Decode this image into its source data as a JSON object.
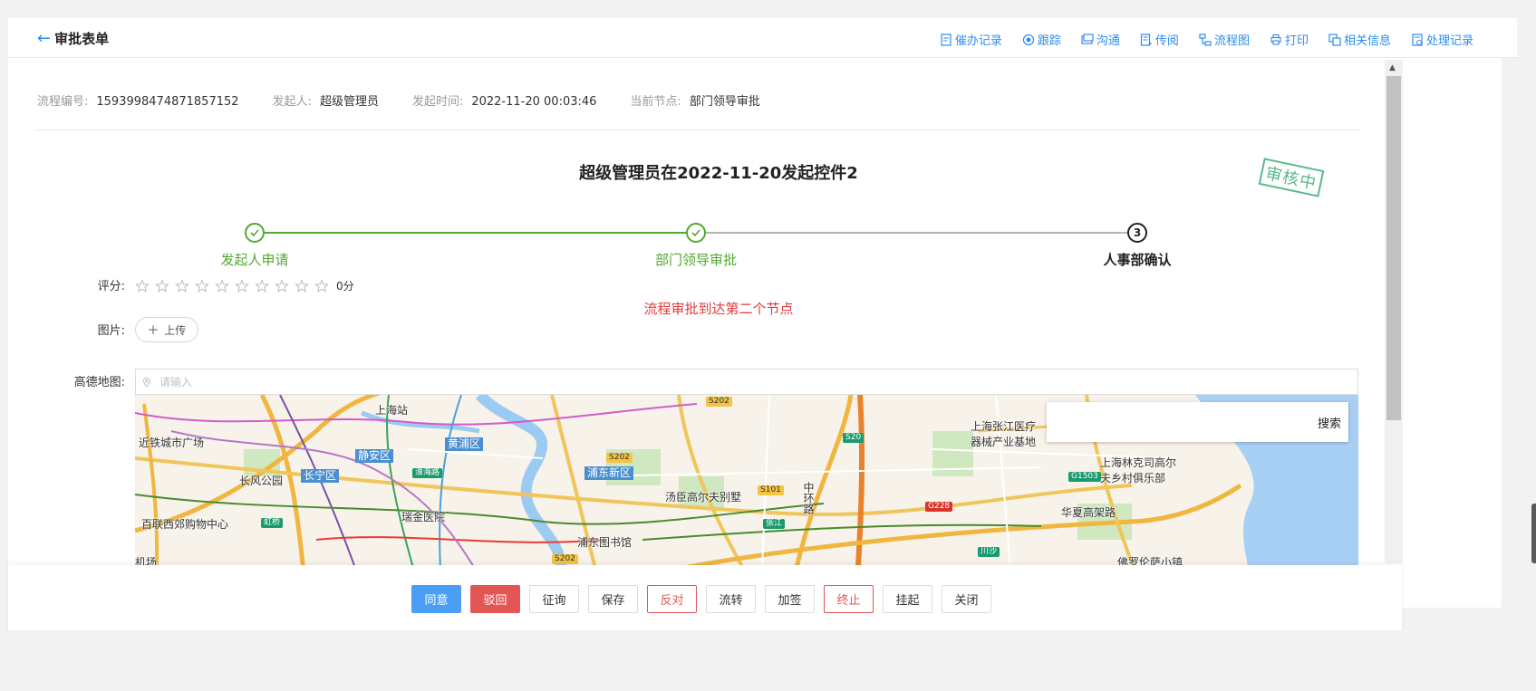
{
  "header": {
    "title": "审批表单",
    "actions": [
      {
        "label": "催办记录",
        "icon": "reminder-record-icon"
      },
      {
        "label": "跟踪",
        "icon": "track-icon"
      },
      {
        "label": "沟通",
        "icon": "chat-icon"
      },
      {
        "label": "传阅",
        "icon": "circulate-icon"
      },
      {
        "label": "流程图",
        "icon": "flowchart-icon"
      },
      {
        "label": "打印",
        "icon": "print-icon"
      },
      {
        "label": "相关信息",
        "icon": "related-info-icon"
      },
      {
        "label": "处理记录",
        "icon": "process-record-icon"
      }
    ]
  },
  "meta": {
    "process_no_label": "流程编号:",
    "process_no": "1593998474871857152",
    "initiator_label": "发起人:",
    "initiator": "超级管理员",
    "start_time_label": "发起时间:",
    "start_time": "2022-11-20 00:03:46",
    "current_node_label": "当前节点:",
    "current_node": "部门领导审批"
  },
  "form": {
    "title": "超级管理员在2022-11-20发起控件2",
    "stamp": "审核中",
    "notice": "流程审批到达第二个节点"
  },
  "steps": [
    {
      "label": "发起人申请",
      "status": "done",
      "number": ""
    },
    {
      "label": "部门领导审批",
      "status": "done",
      "number": ""
    },
    {
      "label": "人事部确认",
      "status": "current",
      "number": "3"
    }
  ],
  "fields": {
    "rating_label": "评分:",
    "rating_value": "0分",
    "rating_max": 10,
    "rating_current": 0,
    "image_label": "图片:",
    "upload_label": "上传",
    "map_label": "高德地图:",
    "map_placeholder": "请输入"
  },
  "map": {
    "search_button": "搜索",
    "place_labels": [
      "上海站",
      "近铁城市广场",
      "静安区",
      "黄浦区",
      "长风公园",
      "长宁区",
      "淮海路",
      "瑞金医院",
      "百联西郊购物中心",
      "虹桥",
      "浦东新区",
      "汤臣高尔夫别墅",
      "中环路",
      "张江",
      "浦东图书馆",
      "机场",
      "上海张江医疗器械产业基地",
      "上海林克司高尔夫乡村俱乐部",
      "华夏高架路",
      "佛罗伦萨小镇",
      "川沙"
    ],
    "road_tags": [
      "S202",
      "S202",
      "S20",
      "S101",
      "G228",
      "G1503",
      "S202"
    ]
  },
  "footer": {
    "buttons": [
      "同意",
      "驳回",
      "征询",
      "保存",
      "反对",
      "流转",
      "加签",
      "终止",
      "挂起",
      "关闭"
    ]
  },
  "colors": {
    "primary": "#4a9ff5",
    "success": "#52a830",
    "danger": "#e25656",
    "link": "#2d8cf0"
  }
}
